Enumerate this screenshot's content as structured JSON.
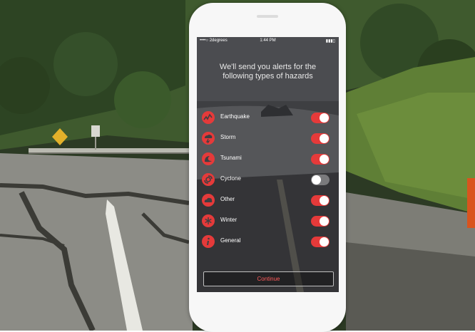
{
  "status_bar": {
    "carrier": "••••○ 2degrees",
    "time": "1:44 PM",
    "battery": "▮▮▮▯"
  },
  "headline": "We'll send you alerts for the following types of hazards",
  "hazards": [
    {
      "label": "Earthquake",
      "icon": "earthquake-icon",
      "on": true
    },
    {
      "label": "Storm",
      "icon": "storm-icon",
      "on": true
    },
    {
      "label": "Tsunami",
      "icon": "tsunami-icon",
      "on": true
    },
    {
      "label": "Cyclone",
      "icon": "cyclone-icon",
      "on": false
    },
    {
      "label": "Other",
      "icon": "cloud-icon",
      "on": true
    },
    {
      "label": "Winter",
      "icon": "snowflake-icon",
      "on": true
    },
    {
      "label": "General",
      "icon": "info-icon",
      "on": true
    }
  ],
  "continue_label": "Continue",
  "colors": {
    "accent": "#e53a3a",
    "toggle_off": "#7a7a7c",
    "continue_text": "#ff5b5b"
  }
}
